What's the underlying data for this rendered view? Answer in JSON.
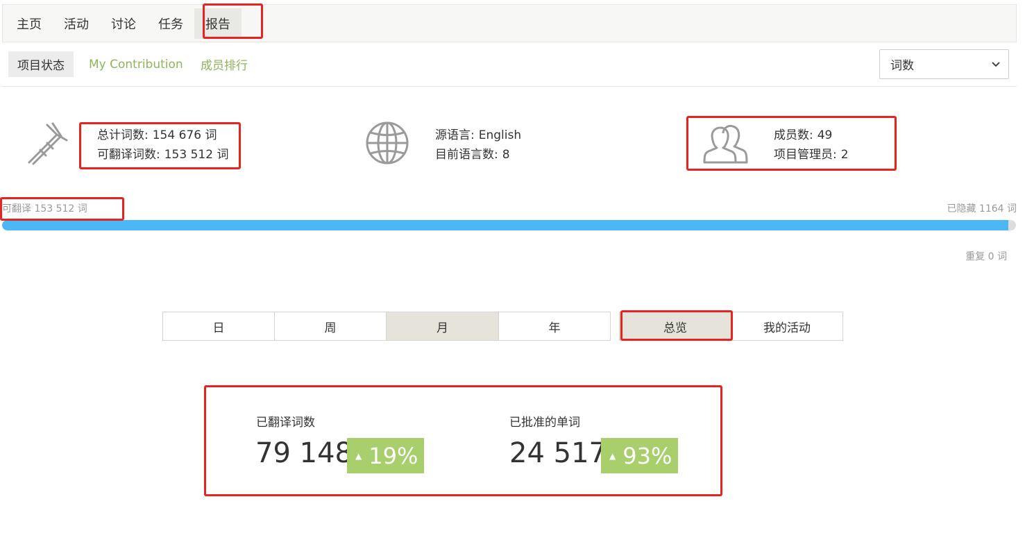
{
  "topnav": {
    "items": [
      {
        "label": "主页"
      },
      {
        "label": "活动"
      },
      {
        "label": "讨论"
      },
      {
        "label": "任务"
      },
      {
        "label": "报告"
      }
    ]
  },
  "subnav": {
    "tabs": [
      {
        "label": "项目状态"
      },
      {
        "label": "My Contribution"
      },
      {
        "label": "成员排行"
      }
    ],
    "metric_select": {
      "value": "词数"
    }
  },
  "stats": {
    "words": {
      "total_label": "总计词数:",
      "total_value": "154 676 词",
      "translatable_label": "可翻译词数:",
      "translatable_value": "153 512 词"
    },
    "languages": {
      "source_label": "源语言:",
      "source_value": "English",
      "target_label": "目前语言数:",
      "target_value": "8"
    },
    "members": {
      "count_label": "成员数:",
      "count_value": "49",
      "managers_label": "项目管理员:",
      "managers_value": "2"
    }
  },
  "progress": {
    "left_label": "可翻译 153 512 词",
    "right_label": "已隐藏 1164 词",
    "repeat_label": "重复 0 词",
    "translatable_percent": 99.25
  },
  "period_tabs": [
    {
      "label": "日"
    },
    {
      "label": "周"
    },
    {
      "label": "月"
    },
    {
      "label": "年"
    }
  ],
  "view_tabs": [
    {
      "label": "总览"
    },
    {
      "label": "我的活动"
    }
  ],
  "summary": {
    "translated": {
      "label": "已翻译词数",
      "value": "79 148",
      "change": "19%"
    },
    "approved": {
      "label": "已批准的单词",
      "value": "24 517",
      "change": "93%"
    }
  },
  "colors": {
    "accent_link": "#8fb55a",
    "progress_fill": "#4bb8f5",
    "trend_badge": "#a8cf6c",
    "annotation": "#e8221f"
  }
}
